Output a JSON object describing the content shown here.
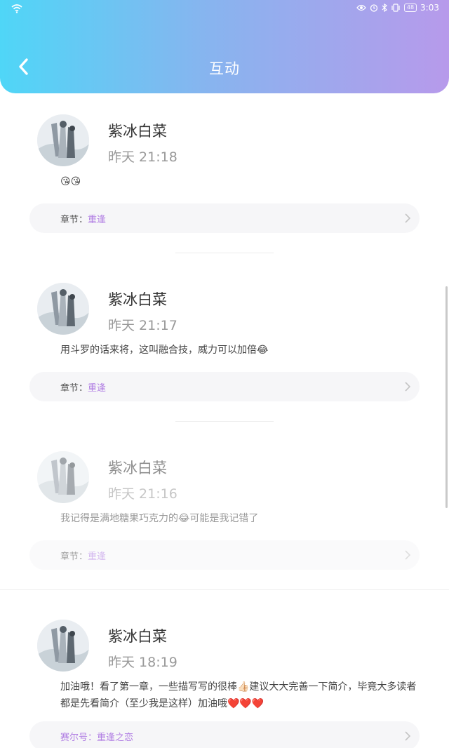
{
  "status_bar": {
    "time": "3:03",
    "battery": "48"
  },
  "header": {
    "title": "互动"
  },
  "comments": [
    {
      "name": "紫冰白菜",
      "time": "昨天 21:18",
      "content": "😘😘",
      "chapter_label": "章节：",
      "chapter_value": "重逢"
    },
    {
      "name": "紫冰白菜",
      "time": "昨天 21:17",
      "content": "用斗罗的话来将，这叫融合技，威力可以加倍😂",
      "chapter_label": "章节：",
      "chapter_value": "重逢"
    },
    {
      "name": "紫冰白菜",
      "time": "昨天 21:16",
      "content": "我记得是满地糖果巧克力的😂可能是我记错了",
      "chapter_label": "章节：",
      "chapter_value": "重逢"
    },
    {
      "name": "紫冰白菜",
      "time": "昨天 18:19",
      "content": "加油哦！看了第一章，一些描写写的很棒👍🏻建议大大完善一下简介，毕竟大多读者都是先看简介（至少我是这样）加油哦❤️❤️❤️",
      "chapter_label": "赛尔号：",
      "chapter_value": "重逢之恋"
    }
  ]
}
